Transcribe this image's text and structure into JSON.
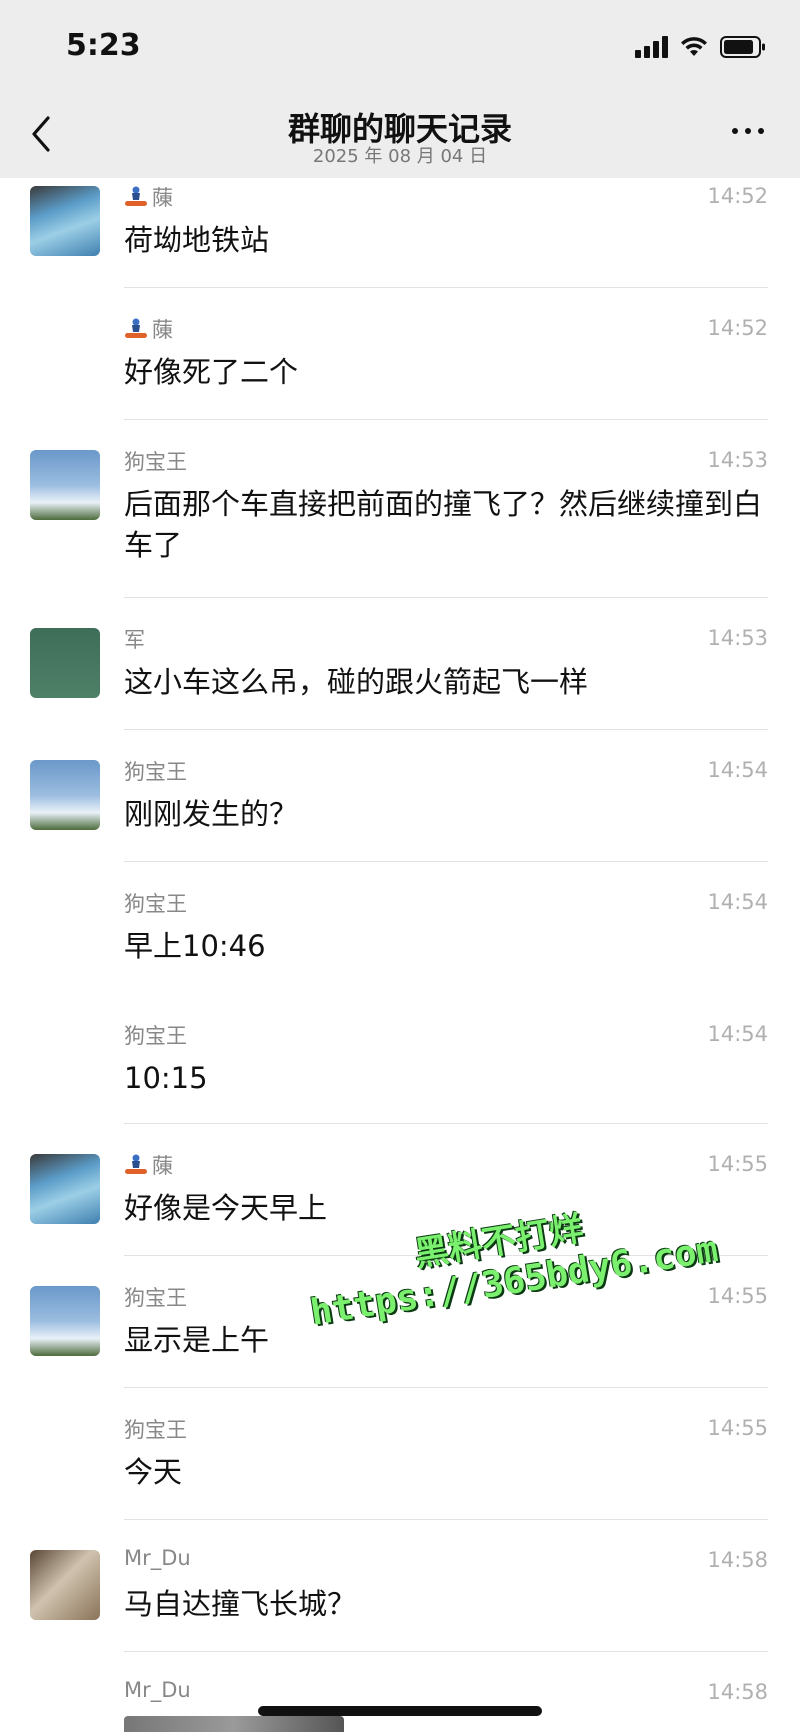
{
  "status_bar": {
    "time": "5:23"
  },
  "nav": {
    "title": "群聊的聊天记录",
    "subtitle": "2025 年 08 月 04 日"
  },
  "messages": [
    {
      "name": "蔯",
      "name_icon": "snowboarder-icon",
      "time": "14:52",
      "text": "荷坳地铁站",
      "avatar": "photo-avatar"
    },
    {
      "name": "蔯",
      "name_icon": "snowboarder-icon",
      "time": "14:52",
      "text": "好像死了二个",
      "avatar": null
    },
    {
      "name": "狗宝王",
      "time": "14:53",
      "text": "后面那个车直接把前面的撞飞了？然后继续撞到白车了",
      "avatar": "sky-avatar"
    },
    {
      "name": "军",
      "time": "14:53",
      "text": "这小车这么吊，碰的跟火箭起飞一样",
      "avatar": "green-avatar"
    },
    {
      "name": "狗宝王",
      "time": "14:54",
      "text": "刚刚发生的？",
      "avatar": "sky-avatar"
    },
    {
      "name": "狗宝王",
      "time": "14:54",
      "text": "早上10:46",
      "avatar": null
    },
    {
      "name": "狗宝王",
      "time": "14:54",
      "text": "10:15",
      "avatar": null
    },
    {
      "name": "蔯",
      "name_icon": "snowboarder-icon",
      "time": "14:55",
      "text": "好像是今天早上",
      "avatar": "photo-avatar"
    },
    {
      "name": "狗宝王",
      "time": "14:55",
      "text": "显示是上午",
      "avatar": "sky-avatar"
    },
    {
      "name": "狗宝王",
      "time": "14:55",
      "text": "今天",
      "avatar": null
    },
    {
      "name": "Mr_Du",
      "time": "14:58",
      "text": "马自达撞飞长城？",
      "avatar": "room-avatar"
    },
    {
      "name": "Mr_Du",
      "time": "14:58",
      "text": "",
      "avatar": null
    }
  ],
  "watermark": {
    "line1": "黑料不打烊",
    "line2": "https://365bdy6.com"
  },
  "colors": {
    "topbar_bg": "#ededed",
    "watermark": "#7bf06e",
    "time": "#b0b0b0",
    "name": "#888888"
  }
}
